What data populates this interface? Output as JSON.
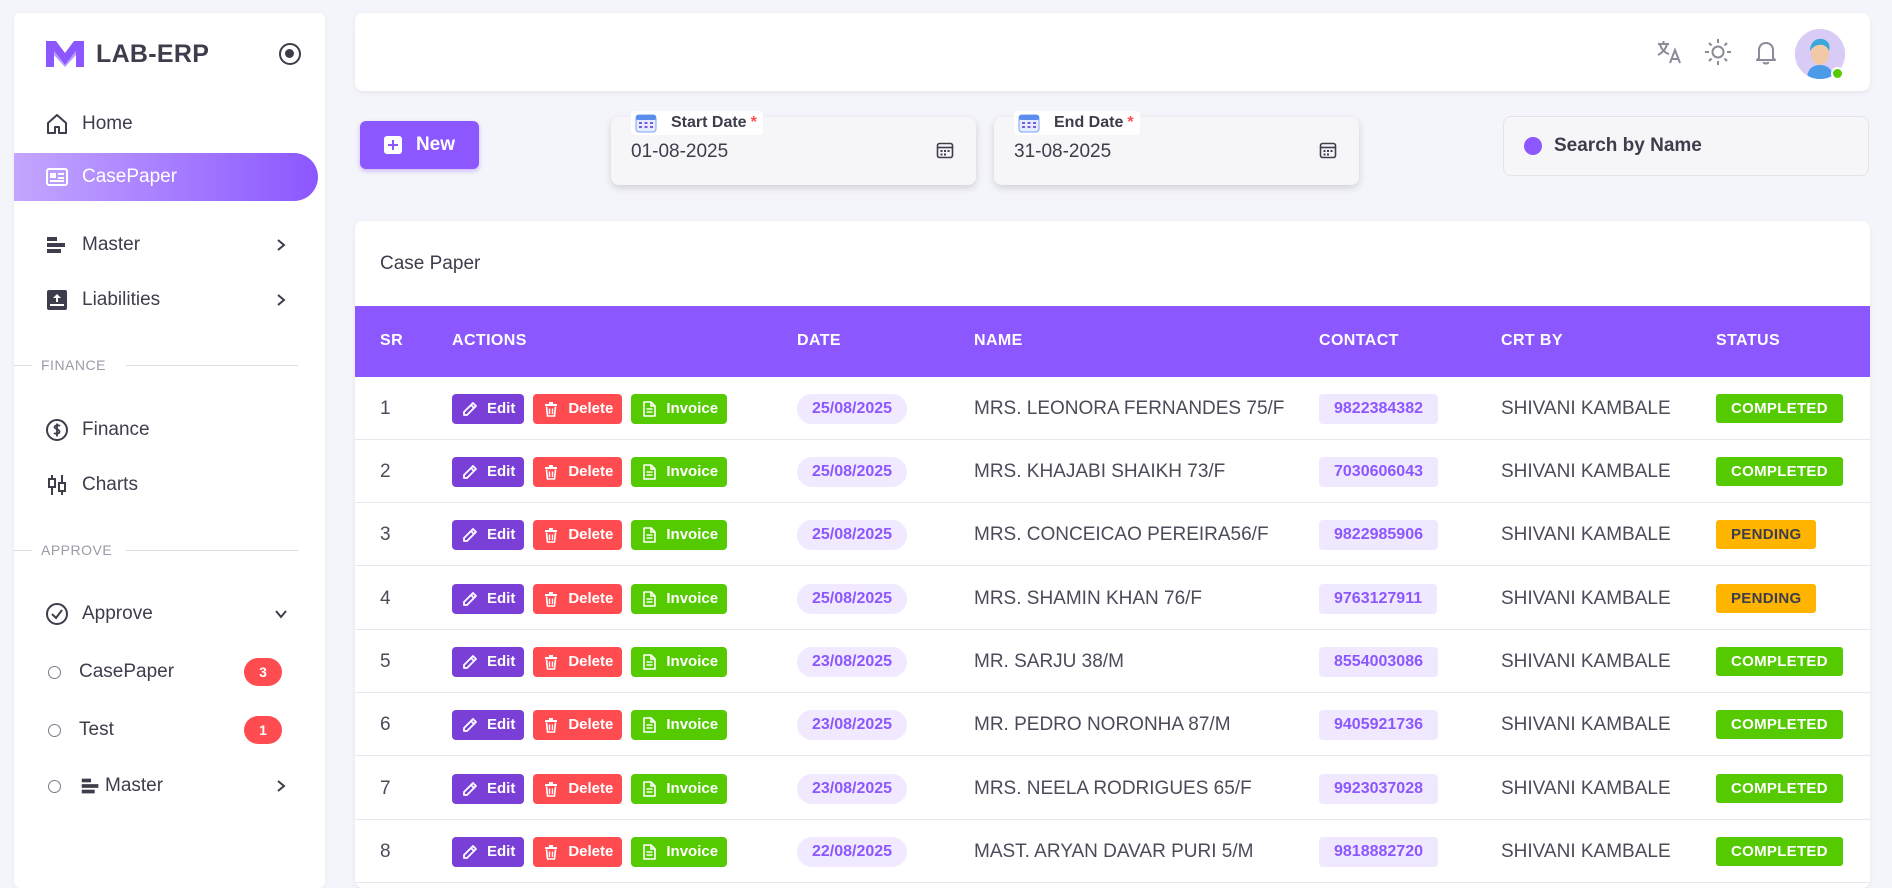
{
  "brand": {
    "name": "LAB-ERP"
  },
  "sidebar": {
    "items": [
      {
        "label": "Home"
      },
      {
        "label": "CasePaper"
      },
      {
        "label": "Master"
      },
      {
        "label": "Liabilities"
      }
    ],
    "finance_section": "FINANCE",
    "finance_items": [
      {
        "label": "Finance"
      },
      {
        "label": "Charts"
      }
    ],
    "approve_section": "APPROVE",
    "approve_group": {
      "label": "Approve"
    },
    "approve_items": [
      {
        "label": "CasePaper",
        "badge": "3"
      },
      {
        "label": "Test",
        "badge": "1"
      },
      {
        "label": "Master"
      }
    ]
  },
  "toolbar": {
    "new_label": "New",
    "start_date": {
      "label": "Start Date",
      "required": "*",
      "value": "01-08-2025"
    },
    "end_date": {
      "label": "End Date",
      "required": "*",
      "value": "31-08-2025"
    },
    "search_placeholder": "Search by Name"
  },
  "card": {
    "title": "Case Paper",
    "columns": [
      "SR",
      "ACTIONS",
      "DATE",
      "NAME",
      "CONTACT",
      "CRT BY",
      "STATUS"
    ],
    "action_labels": {
      "edit": "Edit",
      "delete": "Delete",
      "invoice": "Invoice"
    },
    "rows": [
      {
        "sr": "1",
        "date": "25/08/2025",
        "name": "MRS. LEONORA FERNANDES 75/F",
        "contact": "9822384382",
        "crt_by": "SHIVANI KAMBALE",
        "status": "COMPLETED"
      },
      {
        "sr": "2",
        "date": "25/08/2025",
        "name": "MRS. KHAJABI SHAIKH 73/F",
        "contact": "7030606043",
        "crt_by": "SHIVANI KAMBALE",
        "status": "COMPLETED"
      },
      {
        "sr": "3",
        "date": "25/08/2025",
        "name": "MRS. CONCEICAO PEREIRA56/F",
        "contact": "9822985906",
        "crt_by": "SHIVANI KAMBALE",
        "status": "PENDING"
      },
      {
        "sr": "4",
        "date": "25/08/2025",
        "name": "MRS. SHAMIN KHAN 76/F",
        "contact": "9763127911",
        "crt_by": "SHIVANI KAMBALE",
        "status": "PENDING"
      },
      {
        "sr": "5",
        "date": "23/08/2025",
        "name": "MR. SARJU 38/M",
        "contact": "8554003086",
        "crt_by": "SHIVANI KAMBALE",
        "status": "COMPLETED"
      },
      {
        "sr": "6",
        "date": "23/08/2025",
        "name": "MR. PEDRO NORONHA 87/M",
        "contact": "9405921736",
        "crt_by": "SHIVANI KAMBALE",
        "status": "COMPLETED"
      },
      {
        "sr": "7",
        "date": "23/08/2025",
        "name": "MRS. NEELA RODRIGUES 65/F",
        "contact": "9923037028",
        "crt_by": "SHIVANI KAMBALE",
        "status": "COMPLETED"
      },
      {
        "sr": "8",
        "date": "22/08/2025",
        "name": "MAST. ARYAN DAVAR PURI 5/M",
        "contact": "9818882720",
        "crt_by": "SHIVANI KAMBALE",
        "status": "COMPLETED"
      }
    ]
  },
  "colors": {
    "accent": "#8c57ff",
    "success": "#56ca00",
    "warning": "#ffb400",
    "danger": "#ff4c51",
    "edit": "#7a3fd6"
  },
  "icons": {
    "topbar": [
      "translate-icon",
      "sun-icon",
      "bell-icon"
    ]
  }
}
